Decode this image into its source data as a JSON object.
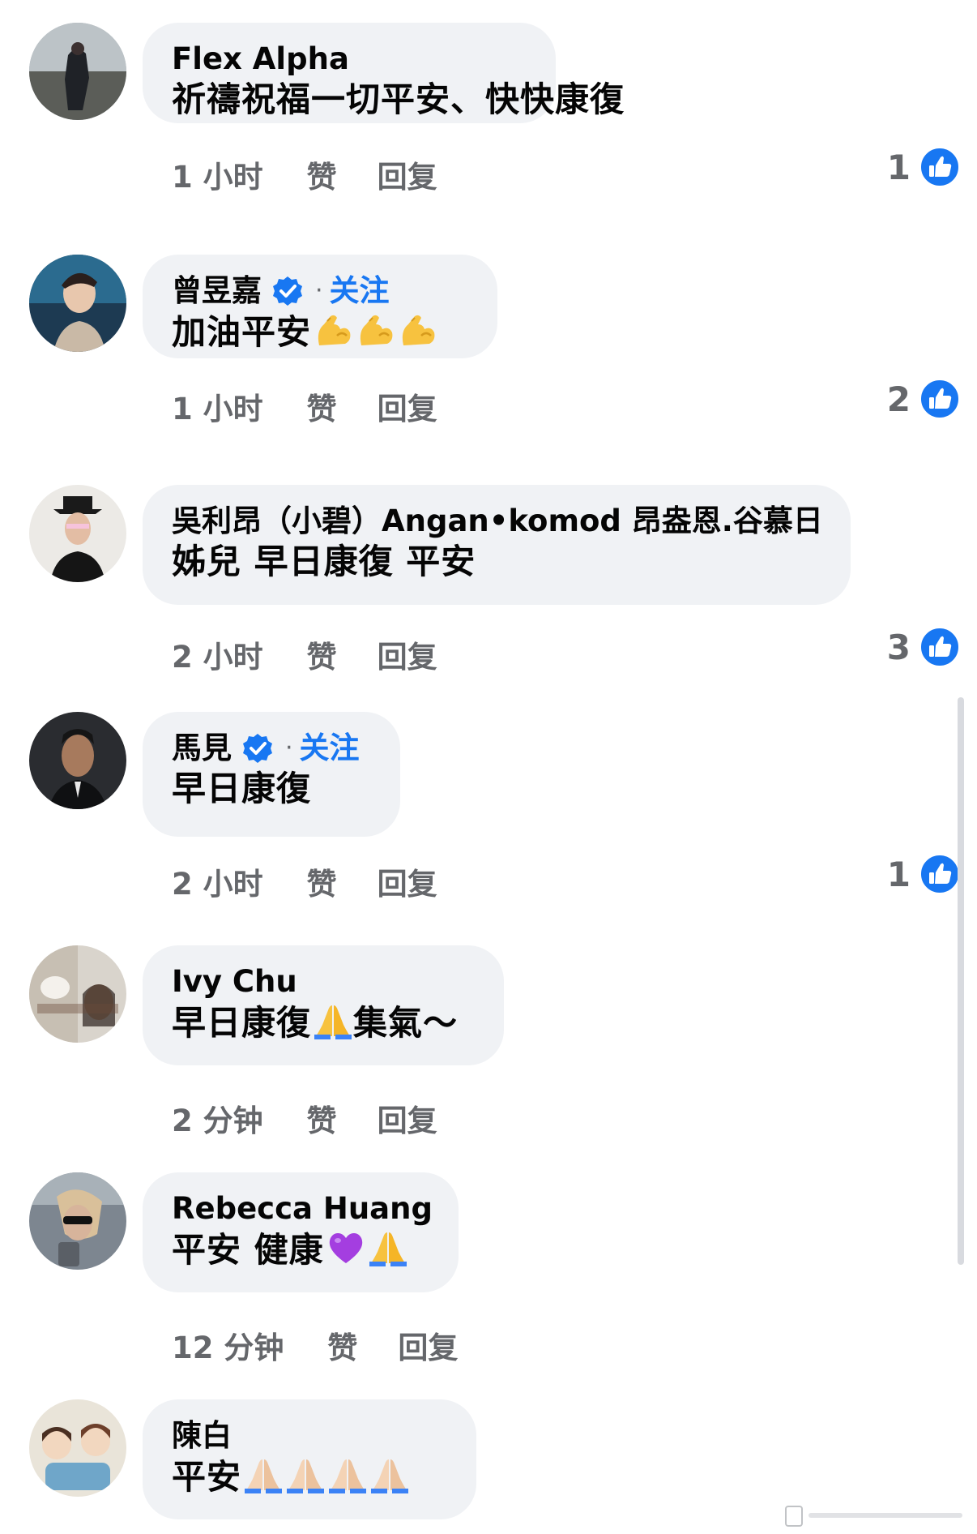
{
  "comments": [
    {
      "author": "Flex Alpha",
      "text": "祈禱祝福一切平安、快快康復",
      "time": "1 小时",
      "like_label": "赞",
      "reply_label": "回复",
      "reaction_count": "1",
      "verified": false
    },
    {
      "author": "曾昱嘉",
      "text": "加油平安",
      "emojis": [
        "flexed-biceps",
        "flexed-biceps",
        "flexed-biceps"
      ],
      "follow_label": "关注",
      "time": "1 小时",
      "like_label": "赞",
      "reply_label": "回复",
      "reaction_count": "2",
      "verified": true
    },
    {
      "author": "吳利昂（小碧）Angan•komod 昂盎恩.谷慕日",
      "text": "姊兒 早日康復 平安",
      "time": "2 小时",
      "like_label": "赞",
      "reply_label": "回复",
      "reaction_count": "3",
      "verified": false
    },
    {
      "author": "馬見",
      "text": "早日康復",
      "follow_label": "关注",
      "time": "2 小时",
      "like_label": "赞",
      "reply_label": "回复",
      "reaction_count": "1",
      "verified": true
    },
    {
      "author": "Ivy Chu",
      "text_before": "早日康復",
      "text_after": "集氣～",
      "emojis": [
        "folded-hands"
      ],
      "time": "2 分钟",
      "like_label": "赞",
      "reply_label": "回复",
      "verified": false
    },
    {
      "author": "Rebecca Huang",
      "text": "平安 健康",
      "emojis": [
        "purple-heart",
        "folded-hands"
      ],
      "time": "12 分钟",
      "like_label": "赞",
      "reply_label": "回复",
      "verified": false
    },
    {
      "author": "陳白",
      "text": "平安",
      "emojis": [
        "folded-hands-light",
        "folded-hands-light",
        "folded-hands-light",
        "folded-hands-light"
      ],
      "verified": false
    }
  ],
  "colors": {
    "bubble": "#f0f2f5",
    "meta": "#65676b",
    "accent": "#1877f2"
  }
}
